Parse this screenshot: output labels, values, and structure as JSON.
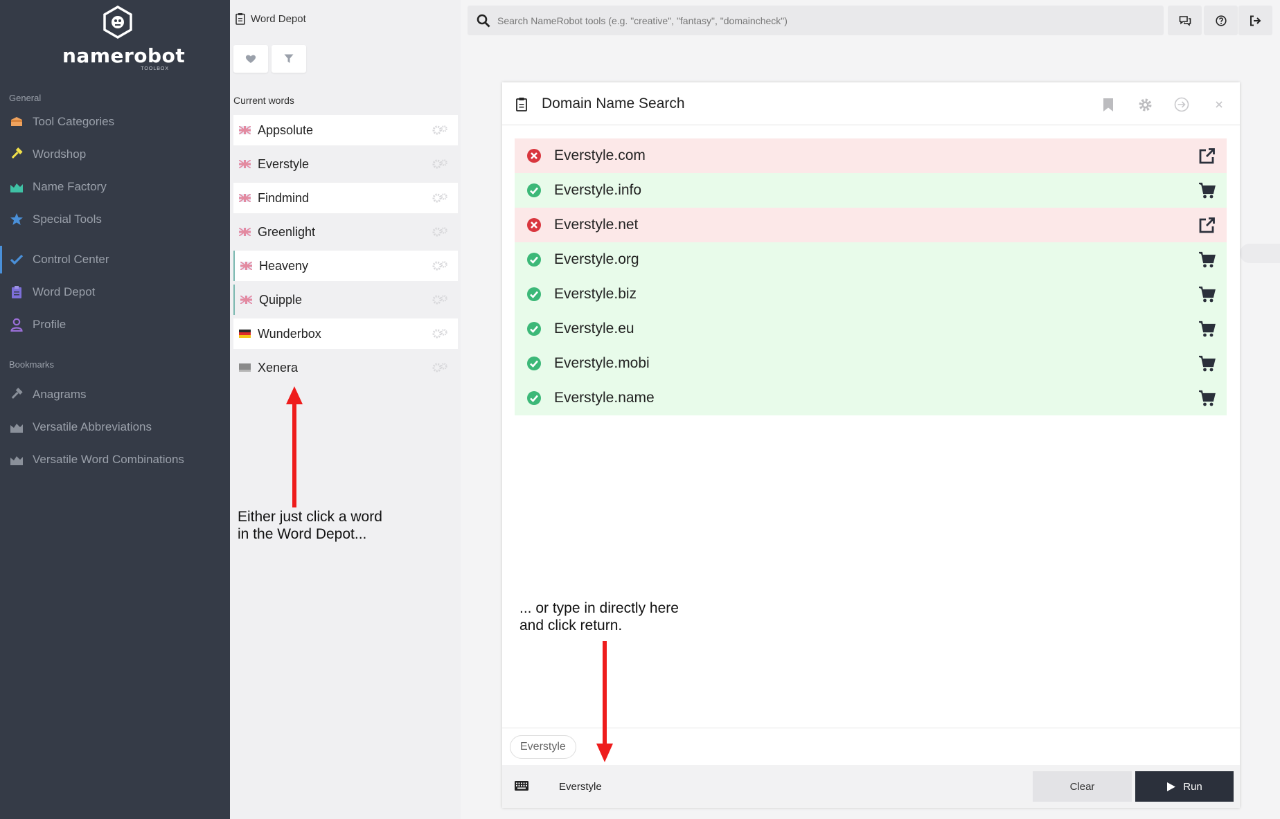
{
  "sidebar": {
    "logo_text": "namerobot",
    "logo_sub": "TOOLBOX",
    "general_label": "General",
    "items": [
      {
        "label": "Tool Categories",
        "icon": "box-icon",
        "color": "#f0a35e"
      },
      {
        "label": "Wordshop",
        "icon": "hammer-icon",
        "color": "#f1e04a"
      },
      {
        "label": "Name Factory",
        "icon": "area-chart-icon",
        "color": "#3fc1a5"
      },
      {
        "label": "Special Tools",
        "icon": "star-icon",
        "color": "#4a90d9"
      },
      {
        "label": "Control Center",
        "icon": "check-icon",
        "color": "#4a90d9"
      },
      {
        "label": "Word Depot",
        "icon": "clipboard-icon",
        "color": "#7d6fd8"
      },
      {
        "label": "Profile",
        "icon": "user-icon",
        "color": "#9b6fd8"
      }
    ],
    "bookmarks_label": "Bookmarks",
    "bookmarks": [
      {
        "label": "Anagrams",
        "icon": "hammer-icon"
      },
      {
        "label": "Versatile Abbreviations",
        "icon": "area-chart-icon"
      },
      {
        "label": "Versatile Word Combinations",
        "icon": "area-chart-icon"
      }
    ]
  },
  "depot": {
    "title": "Word Depot",
    "current_words_label": "Current words",
    "words": [
      {
        "label": "Appsolute",
        "flag": "uk"
      },
      {
        "label": "Everstyle",
        "flag": "uk"
      },
      {
        "label": "Findmind",
        "flag": "uk"
      },
      {
        "label": "Greenlight",
        "flag": "uk"
      },
      {
        "label": "Heaveny",
        "flag": "uk"
      },
      {
        "label": "Quipple",
        "flag": "uk"
      },
      {
        "label": "Wunderbox",
        "flag": "de"
      },
      {
        "label": "Xenera",
        "flag": "none"
      }
    ]
  },
  "search": {
    "placeholder": "Search NameRobot tools (e.g. \"creative\", \"fantasy\", \"domaincheck\")"
  },
  "panel": {
    "title": "Domain Name Search",
    "results": [
      {
        "domain": "Everstyle.com",
        "status": "taken",
        "action": "external-link-icon"
      },
      {
        "domain": "Everstyle.info",
        "status": "free",
        "action": "cart-icon"
      },
      {
        "domain": "Everstyle.net",
        "status": "taken",
        "action": "external-link-icon"
      },
      {
        "domain": "Everstyle.org",
        "status": "free",
        "action": "cart-icon"
      },
      {
        "domain": "Everstyle.biz",
        "status": "free",
        "action": "cart-icon"
      },
      {
        "domain": "Everstyle.eu",
        "status": "free",
        "action": "cart-icon"
      },
      {
        "domain": "Everstyle.mobi",
        "status": "free",
        "action": "cart-icon"
      },
      {
        "domain": "Everstyle.name",
        "status": "free",
        "action": "cart-icon"
      }
    ],
    "chip": "Everstyle",
    "input_value": "Everstyle",
    "clear_label": "Clear",
    "run_label": "Run"
  },
  "annotations": {
    "depot_line1": "Either just click a word",
    "depot_line2": "in the Word Depot...",
    "input_line1": "... or type in directly here",
    "input_line2": "and click return."
  },
  "colors": {
    "sidebar_bg": "#353b47",
    "taken_bg": "#fce8e8",
    "free_bg": "#e8fbea",
    "taken_icon": "#d9363e",
    "free_icon": "#3cb878",
    "run_bg": "#2b303b",
    "arrow": "#ee1c1c"
  }
}
